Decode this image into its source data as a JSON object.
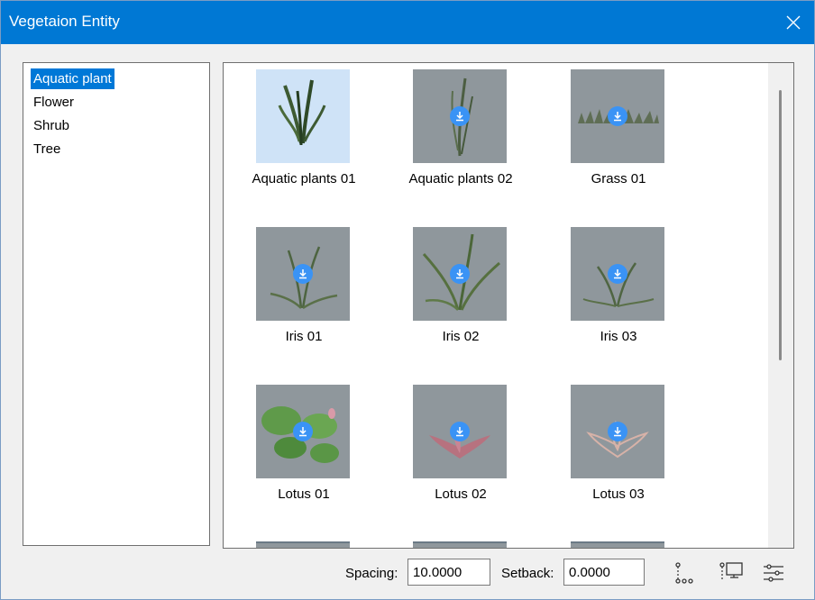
{
  "window": {
    "title": "Vegetaion Entity"
  },
  "categories": [
    "Aquatic plant",
    "Flower",
    "Shrub",
    "Tree"
  ],
  "selected_category": "Aquatic plant",
  "items": [
    {
      "label": "Aquatic plants 01",
      "downloaded": true,
      "selected": true
    },
    {
      "label": "Aquatic plants 02",
      "downloaded": false
    },
    {
      "label": "Grass 01",
      "downloaded": false
    },
    {
      "label": "Iris 01",
      "downloaded": false
    },
    {
      "label": "Iris 02",
      "downloaded": false
    },
    {
      "label": "Iris 03",
      "downloaded": false
    },
    {
      "label": "Lotus 01",
      "downloaded": false
    },
    {
      "label": "Lotus 02",
      "downloaded": false
    },
    {
      "label": "Lotus 03",
      "downloaded": false
    }
  ],
  "footer": {
    "spacing_label": "Spacing:",
    "spacing_value": "10.0000",
    "setback_label": "Setback:",
    "setback_value": "0.0000"
  },
  "icons": {
    "close": "close-icon",
    "download": "download-icon",
    "tools": [
      "vertical-path-icon",
      "screen-path-icon",
      "settings-sliders-icon"
    ]
  },
  "colors": {
    "titlebar": "#0078d4",
    "selection": "#0078d7",
    "download_badge": "#3a93f5",
    "thumb_bg": "#8f979c"
  }
}
